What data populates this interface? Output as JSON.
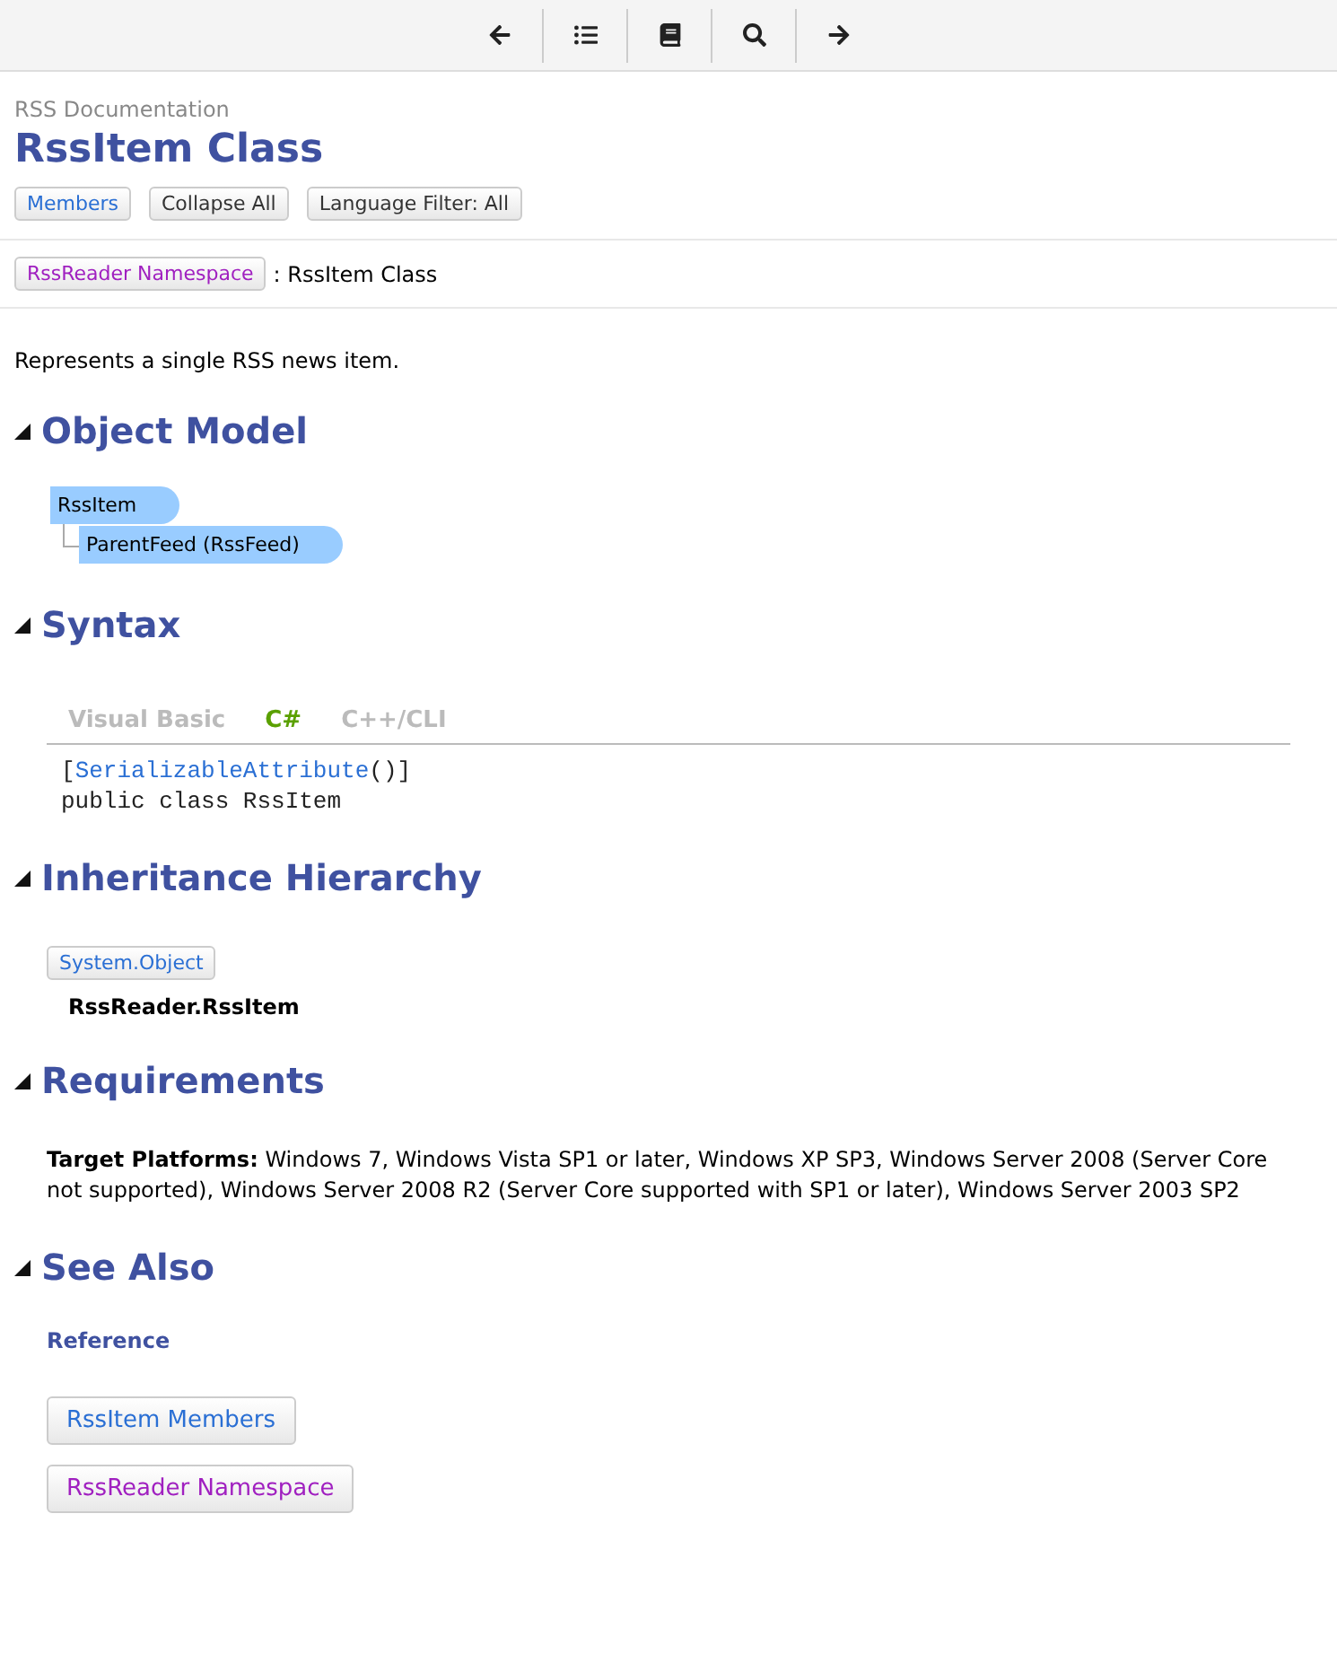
{
  "toolbar": [
    {
      "kind": "back"
    },
    {
      "kind": "toc"
    },
    {
      "kind": "book"
    },
    {
      "kind": "search"
    },
    {
      "kind": "forward"
    }
  ],
  "header": {
    "product": "RSS Documentation",
    "title": "RssItem Class",
    "buttons": [
      {
        "label": "Members",
        "kind": "link",
        "visited": false
      },
      {
        "label": "Collapse All",
        "kind": "plain"
      },
      {
        "label": "Language Filter: All",
        "kind": "plain"
      }
    ]
  },
  "breadcrumb": {
    "link": {
      "label": "RssReader Namespace",
      "visited": true
    },
    "text": ": RssItem Class"
  },
  "summary": "Represents a single RSS news item.",
  "sections": [
    {
      "kind": "object_model",
      "title": "Object Model",
      "expanded": true,
      "nodes": [
        {
          "label": "RssItem",
          "children": [
            {
              "label": "ParentFeed (RssFeed)"
            }
          ]
        }
      ]
    },
    {
      "kind": "syntax",
      "title": "Syntax",
      "expanded": true,
      "tabs": [
        {
          "label": "Visual Basic",
          "selected": false
        },
        {
          "label": "C#",
          "selected": true
        },
        {
          "label": "C++/CLI",
          "selected": false
        }
      ],
      "code": [
        [
          {
            "text": "[",
            "kind": "plain"
          },
          {
            "text": "SerializableAttribute",
            "kind": "type"
          },
          {
            "text": "()]",
            "kind": "plain"
          }
        ],
        [
          {
            "text": "public class RssItem",
            "kind": "plain"
          }
        ]
      ]
    },
    {
      "kind": "inheritance",
      "title": "Inheritance Hierarchy",
      "expanded": true,
      "base": {
        "label": "System.Object",
        "visited": false
      },
      "current": "RssReader.RssItem"
    },
    {
      "kind": "requirements",
      "title": "Requirements",
      "expanded": true,
      "text": "**Target Platforms:** Windows 7, Windows Vista SP1 or later, Windows XP SP3, Windows Server 2008 (Server Core not supported), Windows Server 2008 R2 (Server Core supported with SP1 or later), Windows Server 2003 SP2"
    },
    {
      "kind": "see_also",
      "title": "See Also",
      "expanded": true,
      "subtitle": "Reference",
      "links": [
        {
          "label": "RssItem Members",
          "visited": false
        },
        {
          "label": "RssReader Namespace",
          "visited": true
        }
      ]
    }
  ]
}
